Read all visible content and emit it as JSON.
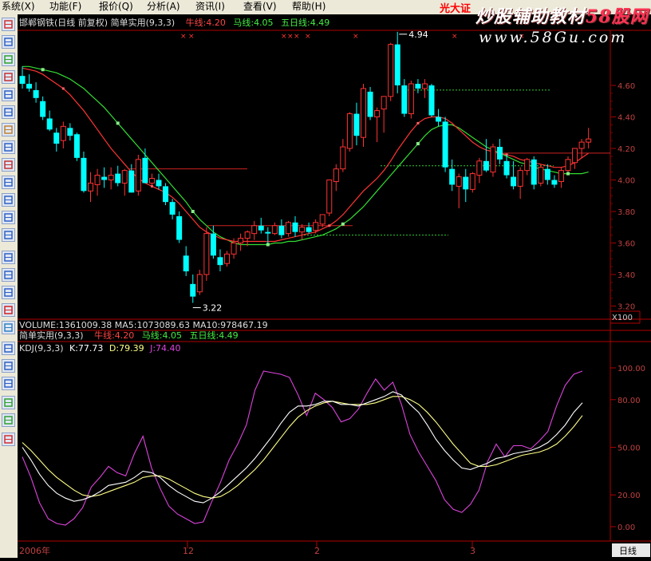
{
  "menu": {
    "items": [
      "系统(X)",
      "功能(F)",
      "报价(Q)",
      "分析(A)",
      "资讯(I)",
      "查看(V)",
      "帮助(H)"
    ],
    "extra": "光大证"
  },
  "watermark": {
    "title_prefix": "炒股辅助教材",
    "title_brand": "58股网",
    "url": "www.58Gu.com"
  },
  "price_panel": {
    "title": "邯郸钢铁(日线 前复权) 简单实用(9,3,3)",
    "niu_line": "牛线:4.20",
    "ma_line": "马线:4.05",
    "five_day_line": "五日线:4.49",
    "y_ticks": [
      "4.60",
      "4.40",
      "4.20",
      "4.00",
      "3.80",
      "3.60",
      "3.40",
      "3.20"
    ],
    "high_label": "4.94",
    "low_label": "3.22",
    "scale_label": "X100",
    "colors": {
      "up": "#ff3333",
      "down": "#00ffff",
      "niu": "#ff3333",
      "ma": "#33dd33",
      "five": "#33dd33"
    }
  },
  "volume_panel": {
    "title": "VOLUME:1361009.38  MA5:1073089.63  MA10:978467.19"
  },
  "indicator_panel": {
    "title": "简单实用(9,3,3)",
    "niu_line": "牛线:4.20",
    "ma_line": "马线:4.05",
    "five_day_line": "五日线:4.49"
  },
  "kdj_panel": {
    "title": "KDJ(9,3,3)",
    "k": "K:77.73",
    "d": "D:79.39",
    "j": "J:74.40",
    "y_ticks": [
      "100.00",
      "80.00",
      "50.00",
      "20.00",
      "0.00"
    ],
    "colors": {
      "k": "#ffffff",
      "d": "#ffff88",
      "j": "#dd44dd"
    }
  },
  "time_axis": {
    "labels": [
      "2006年",
      "12",
      "2",
      "3"
    ],
    "period": "日线"
  },
  "candles": [
    [
      4.66,
      4.72,
      4.58,
      4.61
    ],
    [
      4.61,
      4.67,
      4.56,
      4.58
    ],
    [
      4.57,
      4.62,
      4.49,
      4.52
    ],
    [
      4.5,
      4.53,
      4.38,
      4.4
    ],
    [
      4.39,
      4.44,
      4.31,
      4.32
    ],
    [
      4.3,
      4.33,
      4.18,
      4.23
    ],
    [
      4.25,
      4.37,
      4.2,
      4.34
    ],
    [
      4.33,
      4.36,
      4.25,
      4.28
    ],
    [
      4.29,
      4.3,
      4.12,
      4.14
    ],
    [
      4.14,
      4.18,
      3.92,
      3.93
    ],
    [
      3.93,
      4.05,
      3.86,
      3.98
    ],
    [
      3.97,
      4.07,
      3.9,
      4.03
    ],
    [
      4.02,
      4.08,
      3.95,
      4.0
    ],
    [
      4.0,
      4.08,
      3.94,
      4.03
    ],
    [
      4.04,
      4.09,
      3.96,
      3.98
    ],
    [
      3.98,
      4.07,
      3.9,
      4.06
    ],
    [
      4.06,
      4.1,
      3.92,
      3.92
    ],
    [
      3.93,
      4.16,
      3.9,
      4.13
    ],
    [
      4.14,
      4.2,
      3.98,
      3.98
    ],
    [
      3.98,
      4.04,
      3.96,
      4.01
    ],
    [
      4.0,
      4.04,
      3.94,
      3.96
    ],
    [
      3.96,
      3.98,
      3.84,
      3.86
    ],
    [
      3.86,
      3.88,
      3.75,
      3.78
    ],
    [
      3.77,
      3.8,
      3.6,
      3.62
    ],
    [
      3.52,
      3.58,
      3.39,
      3.42
    ],
    [
      3.34,
      3.4,
      3.22,
      3.26
    ],
    [
      3.29,
      3.43,
      3.27,
      3.4
    ],
    [
      3.4,
      3.7,
      3.36,
      3.66
    ],
    [
      3.66,
      3.71,
      3.5,
      3.52
    ],
    [
      3.51,
      3.56,
      3.42,
      3.46
    ],
    [
      3.47,
      3.55,
      3.45,
      3.53
    ],
    [
      3.53,
      3.63,
      3.5,
      3.6
    ],
    [
      3.6,
      3.66,
      3.55,
      3.63
    ],
    [
      3.63,
      3.68,
      3.58,
      3.67
    ],
    [
      3.66,
      3.74,
      3.62,
      3.71
    ],
    [
      3.71,
      3.76,
      3.66,
      3.68
    ],
    [
      3.67,
      3.7,
      3.6,
      3.66
    ],
    [
      3.66,
      3.73,
      3.65,
      3.71
    ],
    [
      3.71,
      3.75,
      3.63,
      3.65
    ],
    [
      3.66,
      3.74,
      3.64,
      3.73
    ],
    [
      3.73,
      3.77,
      3.64,
      3.67
    ],
    [
      3.67,
      3.72,
      3.62,
      3.7
    ],
    [
      3.7,
      3.73,
      3.66,
      3.67
    ],
    [
      3.68,
      3.75,
      3.66,
      3.73
    ],
    [
      3.72,
      3.78,
      3.7,
      3.78
    ],
    [
      3.79,
      4.0,
      3.77,
      4.0
    ],
    [
      3.99,
      4.1,
      3.93,
      4.07
    ],
    [
      4.07,
      4.26,
      4.05,
      4.21
    ],
    [
      4.2,
      4.43,
      4.18,
      4.42
    ],
    [
      4.42,
      4.49,
      4.22,
      4.28
    ],
    [
      4.27,
      4.61,
      4.21,
      4.58
    ],
    [
      4.56,
      4.59,
      4.38,
      4.4
    ],
    [
      4.4,
      4.46,
      4.24,
      4.44
    ],
    [
      4.45,
      4.53,
      4.3,
      4.53
    ],
    [
      4.53,
      4.87,
      4.5,
      4.86
    ],
    [
      4.86,
      4.94,
      4.55,
      4.6
    ],
    [
      4.6,
      4.64,
      4.4,
      4.42
    ],
    [
      4.42,
      4.63,
      4.39,
      4.61
    ],
    [
      4.61,
      4.64,
      4.55,
      4.58
    ],
    [
      4.58,
      4.64,
      4.52,
      4.61
    ],
    [
      4.6,
      4.61,
      4.4,
      4.41
    ],
    [
      4.4,
      4.45,
      4.34,
      4.37
    ],
    [
      4.37,
      4.4,
      4.05,
      4.08
    ],
    [
      4.07,
      4.13,
      3.93,
      3.97
    ],
    [
      3.96,
      4.04,
      3.82,
      4.02
    ],
    [
      4.02,
      4.07,
      3.86,
      3.94
    ],
    [
      3.94,
      4.05,
      3.92,
      4.04
    ],
    [
      4.03,
      4.14,
      3.98,
      4.12
    ],
    [
      4.12,
      4.26,
      4.05,
      4.06
    ],
    [
      4.05,
      4.23,
      4.02,
      4.21
    ],
    [
      4.21,
      4.26,
      4.1,
      4.13
    ],
    [
      4.12,
      4.16,
      4.01,
      4.03
    ],
    [
      4.02,
      4.12,
      3.94,
      3.96
    ],
    [
      3.96,
      4.08,
      3.88,
      4.06
    ],
    [
      4.06,
      4.14,
      4.03,
      4.13
    ],
    [
      4.13,
      4.15,
      3.94,
      3.97
    ],
    [
      3.98,
      4.1,
      3.96,
      4.08
    ],
    [
      4.07,
      4.1,
      3.97,
      4.0
    ],
    [
      4.0,
      4.03,
      3.95,
      3.97
    ],
    [
      3.99,
      4.08,
      3.95,
      4.06
    ],
    [
      4.06,
      4.15,
      4.05,
      4.13
    ],
    [
      4.11,
      4.2,
      4.07,
      4.2
    ],
    [
      4.2,
      4.26,
      4.14,
      4.24
    ],
    [
      4.24,
      4.33,
      4.2,
      4.26
    ]
  ],
  "niu_series": [
    4.71,
    4.7,
    4.69,
    4.67,
    4.64,
    4.61,
    4.58,
    4.54,
    4.49,
    4.44,
    4.38,
    4.32,
    4.26,
    4.2,
    4.15,
    4.1,
    4.05,
    4.01,
    3.98,
    3.96,
    3.94,
    3.92,
    3.89,
    3.85,
    3.8,
    3.75,
    3.7,
    3.67,
    3.65,
    3.63,
    3.62,
    3.61,
    3.61,
    3.61,
    3.61,
    3.61,
    3.61,
    3.61,
    3.62,
    3.63,
    3.64,
    3.65,
    3.66,
    3.67,
    3.69,
    3.71,
    3.74,
    3.78,
    3.83,
    3.88,
    3.93,
    3.97,
    4.01,
    4.06,
    4.12,
    4.19,
    4.25,
    4.31,
    4.36,
    4.39,
    4.4,
    4.4,
    4.39,
    4.36,
    4.32,
    4.28,
    4.24,
    4.21,
    4.19,
    4.18,
    4.17,
    4.16,
    4.15,
    4.13,
    4.12,
    4.11,
    4.1,
    4.09,
    4.08,
    4.08,
    4.09,
    4.11,
    4.14,
    4.17
  ],
  "ma_series": [
    4.72,
    4.72,
    4.71,
    4.7,
    4.69,
    4.68,
    4.66,
    4.64,
    4.61,
    4.58,
    4.54,
    4.5,
    4.46,
    4.41,
    4.36,
    4.31,
    4.26,
    4.21,
    4.16,
    4.11,
    4.06,
    4.01,
    3.96,
    3.91,
    3.86,
    3.8,
    3.75,
    3.71,
    3.67,
    3.64,
    3.62,
    3.6,
    3.59,
    3.59,
    3.59,
    3.59,
    3.59,
    3.6,
    3.6,
    3.61,
    3.61,
    3.62,
    3.63,
    3.64,
    3.65,
    3.67,
    3.69,
    3.72,
    3.75,
    3.79,
    3.83,
    3.88,
    3.93,
    3.98,
    4.03,
    4.08,
    4.13,
    4.18,
    4.23,
    4.28,
    4.32,
    4.34,
    4.35,
    4.35,
    4.33,
    4.3,
    4.27,
    4.24,
    4.21,
    4.19,
    4.17,
    4.15,
    4.13,
    4.11,
    4.1,
    4.08,
    4.07,
    4.06,
    4.05,
    4.04,
    4.04,
    4.04,
    4.04,
    4.05
  ],
  "kdj": {
    "k": [
      50,
      42,
      33,
      26,
      21,
      18,
      16,
      17,
      19,
      22,
      26,
      27,
      28,
      31,
      35,
      34,
      31,
      26,
      22,
      19,
      16,
      15,
      18,
      22,
      27,
      32,
      37,
      43,
      50,
      57,
      65,
      72,
      76,
      76,
      77,
      79,
      79,
      77,
      77,
      76,
      78,
      80,
      82,
      85,
      83,
      77,
      72,
      64,
      55,
      48,
      42,
      37,
      36,
      38,
      40,
      43,
      44,
      46,
      47,
      48,
      50,
      53,
      58,
      64,
      72,
      78
    ],
    "d": [
      53,
      48,
      42,
      36,
      31,
      27,
      23,
      20,
      19,
      20,
      22,
      24,
      26,
      28,
      31,
      32,
      32,
      30,
      27,
      24,
      21,
      19,
      18,
      19,
      22,
      26,
      31,
      36,
      42,
      49,
      56,
      63,
      69,
      73,
      76,
      78,
      79,
      78,
      77,
      77,
      77,
      78,
      80,
      82,
      82,
      80,
      77,
      72,
      66,
      59,
      52,
      46,
      40,
      38,
      38,
      39,
      41,
      43,
      45,
      46,
      47,
      49,
      52,
      57,
      63,
      70
    ],
    "j": [
      44,
      31,
      15,
      5,
      2,
      1,
      5,
      12,
      25,
      31,
      38,
      34,
      32,
      46,
      57,
      37,
      24,
      13,
      8,
      5,
      2,
      3,
      16,
      28,
      42,
      52,
      64,
      86,
      98,
      97,
      96,
      94,
      83,
      70,
      84,
      80,
      75,
      66,
      68,
      74,
      84,
      93,
      86,
      91,
      77,
      58,
      47,
      38,
      29,
      17,
      11,
      9,
      14,
      23,
      41,
      52,
      44,
      51,
      51,
      49,
      54,
      60,
      76,
      89,
      96,
      98
    ]
  }
}
